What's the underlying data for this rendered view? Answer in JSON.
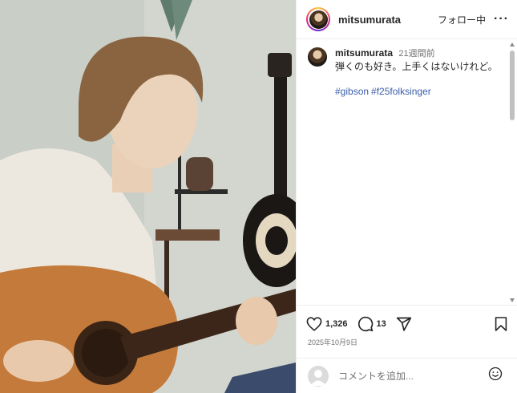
{
  "header": {
    "username": "mitsumurata",
    "follow_label": "フォロー中",
    "more_label": "···"
  },
  "caption": {
    "username": "mitsumurata",
    "time_ago": "21週間前",
    "text": "弾くのも好き。上手くはないけれど。",
    "hashtags": [
      "#gibson",
      "#f25folksinger"
    ]
  },
  "actions": {
    "likes": "1,326",
    "comments": "13",
    "date": "2025年10月9日",
    "icons": [
      "heart-icon",
      "comment-icon",
      "share-icon",
      "bookmark-icon"
    ]
  },
  "comment_box": {
    "placeholder": "コメントを追加..."
  },
  "colors": {
    "text": "#262626",
    "muted": "#737373",
    "link": "#3a5ea9",
    "border": "#efefef"
  }
}
